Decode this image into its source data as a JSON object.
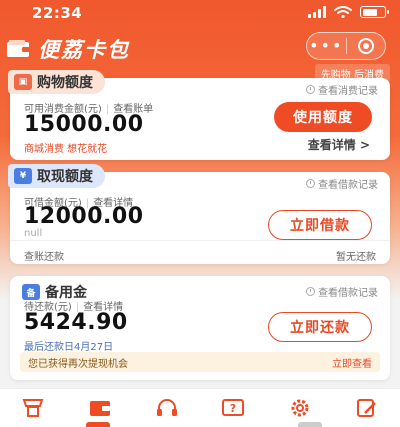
{
  "status": {
    "time": "22:34"
  },
  "header": {
    "title": "便荔卡包",
    "more_icon": "•••",
    "tagline": "先购物 后消费"
  },
  "shopping": {
    "title": "购物额度",
    "record_link": "查看消费记录",
    "label": "可用消费金额(元)",
    "bill_link": "查看账单",
    "amount": "15000.00",
    "hint": "商城消费 想花就花",
    "button": "使用额度",
    "detail_link": "查看详情 >"
  },
  "cash": {
    "title": "取现额度",
    "record_link": "查看借款记录",
    "label": "可借金额(元)",
    "detail_link": "查看详情",
    "amount": "12000.00",
    "sub": "null",
    "button": "立即借款",
    "repay_left": "查账还款",
    "repay_right": "暂无还款"
  },
  "reserve": {
    "title": "备用金",
    "record_link": "查看借款记录",
    "label": "待还款(元)",
    "detail_link": "查看详情",
    "amount": "5424.90",
    "last_date": "最后还款日4月27日",
    "button": "立即还款",
    "notice": "您已获得再次提现机会",
    "notice_action": "立即查看"
  },
  "colors": {
    "accent": "#ef4b24",
    "hero": "#f0582d"
  },
  "tabs": [
    "shop-icon",
    "wallet-icon",
    "headset-icon",
    "help-icon",
    "settings-icon",
    "edit-icon"
  ]
}
